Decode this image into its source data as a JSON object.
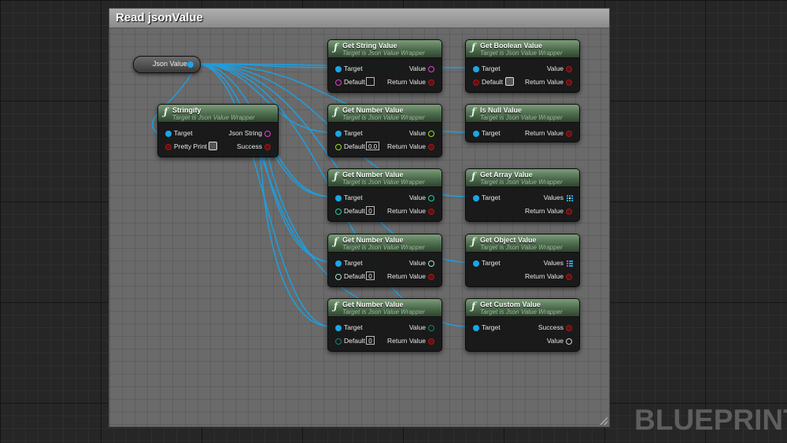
{
  "comment": {
    "title": "Read jsonValue"
  },
  "watermark": "BLUEPRINT",
  "variable": {
    "label": "Json Value"
  },
  "target_subtitle": "Target is Json Value Wrapper",
  "nodes": {
    "stringify": {
      "title": "Stringify",
      "pins": {
        "target": "Target",
        "json_string": "Json String",
        "pretty_print": "Pretty Print",
        "success": "Success"
      }
    },
    "get_string_value": {
      "title": "Get String Value",
      "pins": {
        "target": "Target",
        "value": "Value",
        "default": "Default",
        "return_value": "Return Value"
      },
      "default_value": ""
    },
    "get_number_value_1": {
      "title": "Get Number Value",
      "pins": {
        "target": "Target",
        "value": "Value",
        "default": "Default",
        "return_value": "Return Value"
      },
      "default_value": "0.0"
    },
    "get_number_value_2": {
      "title": "Get Number Value",
      "pins": {
        "target": "Target",
        "value": "Value",
        "default": "Default",
        "return_value": "Return Value"
      },
      "default_value": "0"
    },
    "get_number_value_3": {
      "title": "Get Number Value",
      "pins": {
        "target": "Target",
        "value": "Value",
        "default": "Default",
        "return_value": "Return Value"
      },
      "default_value": "0"
    },
    "get_number_value_4": {
      "title": "Get Number Value",
      "pins": {
        "target": "Target",
        "value": "Value",
        "default": "Default",
        "return_value": "Return Value"
      },
      "default_value": "0"
    },
    "get_boolean_value": {
      "title": "Get Boolean Value",
      "pins": {
        "target": "Target",
        "value": "Value",
        "default": "Default",
        "return_value": "Return Value"
      }
    },
    "is_null_value": {
      "title": "Is Null Value",
      "pins": {
        "target": "Target",
        "return_value": "Return Value"
      }
    },
    "get_array_value": {
      "title": "Get Array Value",
      "pins": {
        "target": "Target",
        "values": "Values",
        "return_value": "Return Value"
      }
    },
    "get_object_value": {
      "title": "Get Object Value",
      "pins": {
        "target": "Target",
        "values": "Values",
        "return_value": "Return Value"
      }
    },
    "get_custom_value": {
      "title": "Get Custom Value",
      "pins": {
        "target": "Target",
        "success": "Success",
        "value": "Value"
      }
    }
  },
  "colors": {
    "wire": "#1e9fe0",
    "string_pin": "#e43ed1",
    "float_pin": "#9edb1e",
    "int_pin": "#1fd3a0",
    "int64_pin": "#a7e0c8",
    "byte_pin": "#0c6a5c",
    "bool_pin": "#9a1c1c",
    "object_pin": "#1aa6e8",
    "node_header": "#4b6a4b"
  }
}
